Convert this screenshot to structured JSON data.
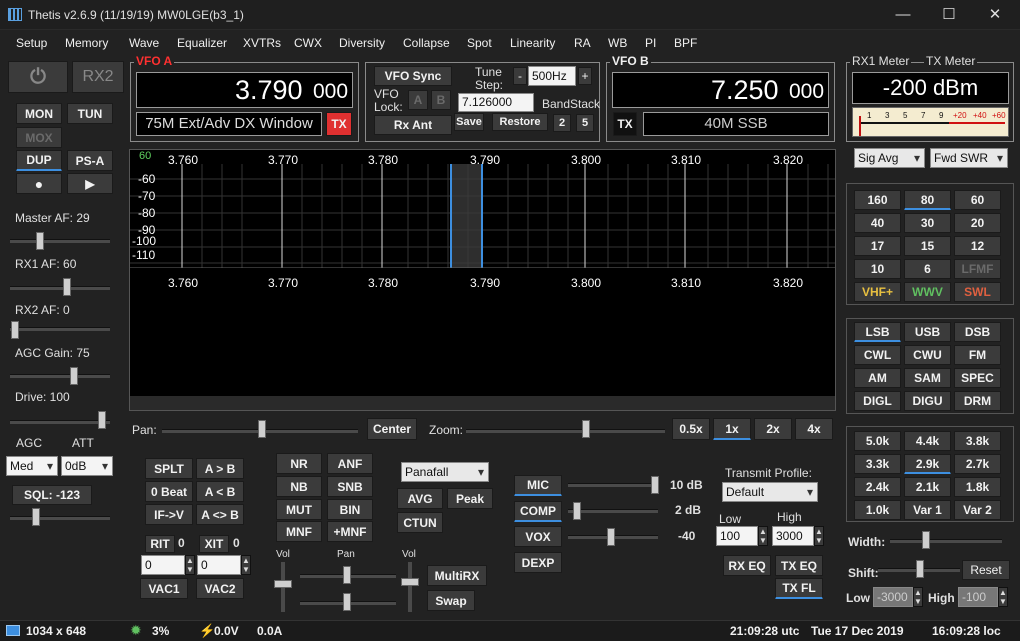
{
  "window": {
    "title": "Thetis v2.6.9 (11/19/19) MW0LGE(b3_1)",
    "minimize": "—",
    "maximize": "☐",
    "close": "✕"
  },
  "menu": [
    "Setup",
    "Memory",
    "Wave",
    "Equalizer",
    "XVTRs",
    "CWX",
    "Diversity",
    "Collapse",
    "Spot",
    "Linearity",
    "RA",
    "WB",
    "PI",
    "BPF"
  ],
  "left": {
    "power_glyph": "⏻",
    "rx2": "RX2",
    "mon": "MON",
    "tun": "TUN",
    "mox": "MOX",
    "dup": "DUP",
    "psa": "PS-A",
    "record_glyph": "●",
    "play_glyph": "▶",
    "master_af": "Master AF:  29",
    "rx1_af": "RX1 AF:  60",
    "rx2_af": "RX2 AF:  0",
    "agc_gain": "AGC Gain:  75",
    "drive": "Drive:  100",
    "agc_label": "AGC",
    "att_label": "ATT",
    "agc_value": "Med",
    "att_value": "0dB",
    "sql": "SQL:  -123",
    "master_af_level": 29,
    "rx1_af_level": 60,
    "rx2_af_level": 0,
    "agc_gain_level": 75,
    "drive_level": 100
  },
  "vfoa": {
    "title": "VFO A",
    "freq_main": "3.790",
    "freq_sub": "000",
    "band_text": "75M Ext/Adv DX Window",
    "tx": "TX"
  },
  "mid": {
    "vfo_sync": "VFO Sync",
    "tune_step_label": "Tune Step:",
    "step_minus": "-",
    "step_value": "500Hz",
    "step_plus": "+",
    "vfo_lock_label": "VFO Lock:",
    "lock_a": "A",
    "lock_b": "B",
    "lock_freq": "7.126000",
    "bandstack_label": "BandStack",
    "rx_ant": "Rx Ant",
    "save": "Save",
    "restore": "Restore",
    "bs_2": "2",
    "bs_5": "5"
  },
  "vfob": {
    "title": "VFO B",
    "freq_main": "7.250",
    "freq_sub": "000",
    "tx": "TX",
    "band_text": "40M SSB"
  },
  "meter": {
    "rx1_label": "RX1 Meter",
    "tx_label": "TX Meter",
    "value": "-200 dBm",
    "scale": [
      "1",
      "3",
      "5",
      "7",
      "9",
      "+20",
      "+40",
      "+60"
    ],
    "rx_mode": "Sig Avg",
    "tx_mode": "Fwd SWR"
  },
  "panadapter": {
    "freqs": [
      "3.760",
      "3.770",
      "3.780",
      "3.790",
      "3.800",
      "3.810",
      "3.820"
    ],
    "dbm_top": "60",
    "dbm": [
      "-60",
      "-70",
      "-80",
      "-90",
      "-100",
      "-110"
    ]
  },
  "pan_controls": {
    "pan_label": "Pan:",
    "center": "Center",
    "zoom_label": "Zoom:",
    "z05": "0.5x",
    "z1": "1x",
    "z2": "2x",
    "z4": "4x"
  },
  "dsp": {
    "splt": "SPLT",
    "a_to_b": "A > B",
    "zero_beat": "0 Beat",
    "a_lt_b": "A < B",
    "if_v": "IF->V",
    "a_swap_b": "A <> B",
    "rit": "RIT",
    "rit_n": "0",
    "xit": "XIT",
    "xit_n": "0",
    "rit_value": "0",
    "xit_value": "0",
    "vac1": "VAC1",
    "vac2": "VAC2",
    "nr": "NR",
    "anf": "ANF",
    "nb": "NB",
    "snb": "SNB",
    "mut": "MUT",
    "bin": "BIN",
    "mnf": "MNF",
    "pmnf": "+MNF",
    "vol1": "Vol",
    "pan": "Pan",
    "vol2": "Vol",
    "multirx": "MultiRX",
    "swap": "Swap",
    "display_mode": "Panafall",
    "avg": "AVG",
    "peak": "Peak",
    "ctun": "CTUN"
  },
  "tx": {
    "mic": "MIC",
    "mic_val": "10 dB",
    "comp": "COMP",
    "comp_val": "2 dB",
    "vox": "VOX",
    "vox_val": "-40",
    "dexp": "DEXP",
    "profile_label": "Transmit Profile:",
    "profile": "Default",
    "low_label": "Low",
    "high_label": "High",
    "low": "100",
    "high": "3000",
    "rx_eq": "RX EQ",
    "tx_eq": "TX EQ",
    "tx_fl": "TX FL"
  },
  "bands": [
    "160",
    "80",
    "60",
    "40",
    "30",
    "20",
    "17",
    "15",
    "12",
    "10",
    "6",
    "LFMF",
    "VHF+",
    "WWV",
    "SWL"
  ],
  "modes": [
    "LSB",
    "USB",
    "DSB",
    "CWL",
    "CWU",
    "FM",
    "AM",
    "SAM",
    "SPEC",
    "DIGL",
    "DIGU",
    "DRM"
  ],
  "filters": [
    "5.0k",
    "4.4k",
    "3.8k",
    "3.3k",
    "2.9k",
    "2.7k",
    "2.4k",
    "2.1k",
    "1.8k",
    "1.0k",
    "Var 1",
    "Var 2"
  ],
  "filter_ctl": {
    "width": "Width:",
    "shift": "Shift:",
    "reset": "Reset",
    "low": "Low",
    "low_val": "-3000",
    "high": "High",
    "high_val": "-100"
  },
  "status": {
    "size": "1034 x 648",
    "cpu": "3%",
    "volts": "0.0V",
    "amps": "0.0A",
    "utc": "21:09:28 utc",
    "date": "Tue 17 Dec 2019",
    "loc": "16:09:28 loc"
  },
  "colors": {
    "accent": "#3d8fe0",
    "tx_red": "#e03030",
    "vhf": "#e8c040",
    "wwv": "#60c060",
    "swl": "#e06040",
    "lfmf": "#6a6a6a"
  }
}
